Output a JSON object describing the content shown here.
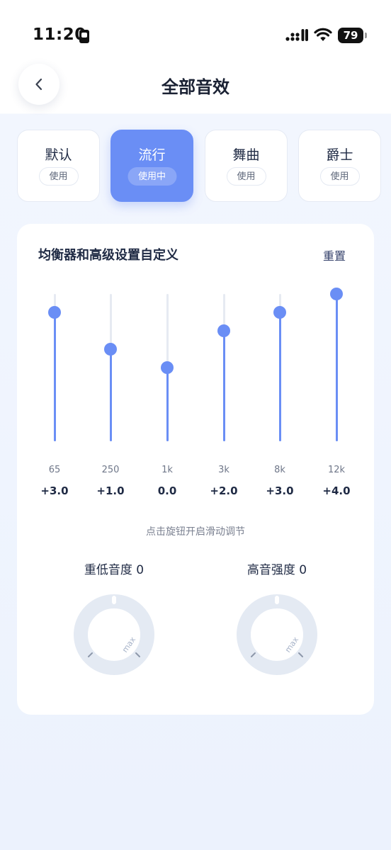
{
  "status_bar": {
    "time": "11:20",
    "battery": "79"
  },
  "header": {
    "title": "全部音效"
  },
  "presets": [
    {
      "name": "默认",
      "status": "使用",
      "active": false
    },
    {
      "name": "流行",
      "status": "使用中",
      "active": true
    },
    {
      "name": "舞曲",
      "status": "使用",
      "active": false
    },
    {
      "name": "爵士",
      "status": "使用",
      "active": false
    }
  ],
  "equalizer": {
    "title": "均衡器和高级设置自定义",
    "reset_label": "重置",
    "bands": [
      {
        "freq": "65",
        "gain": "+3.0",
        "level": 0.875
      },
      {
        "freq": "250",
        "gain": "+1.0",
        "level": 0.625
      },
      {
        "freq": "1k",
        "gain": "0.0",
        "level": 0.5
      },
      {
        "freq": "3k",
        "gain": "+2.0",
        "level": 0.75
      },
      {
        "freq": "8k",
        "gain": "+3.0",
        "level": 0.875
      },
      {
        "freq": "12k",
        "gain": "+4.0",
        "level": 1.0
      }
    ]
  },
  "knobs": {
    "hint": "点击旋钮开启滑动调节",
    "bass_label": "重低音度 0",
    "treble_label": "高音强度 0",
    "max_label": "max"
  },
  "colors": {
    "accent": "#6a8ef5",
    "track": "#e6eaf2",
    "knob_ring": "#e4eaf3"
  }
}
